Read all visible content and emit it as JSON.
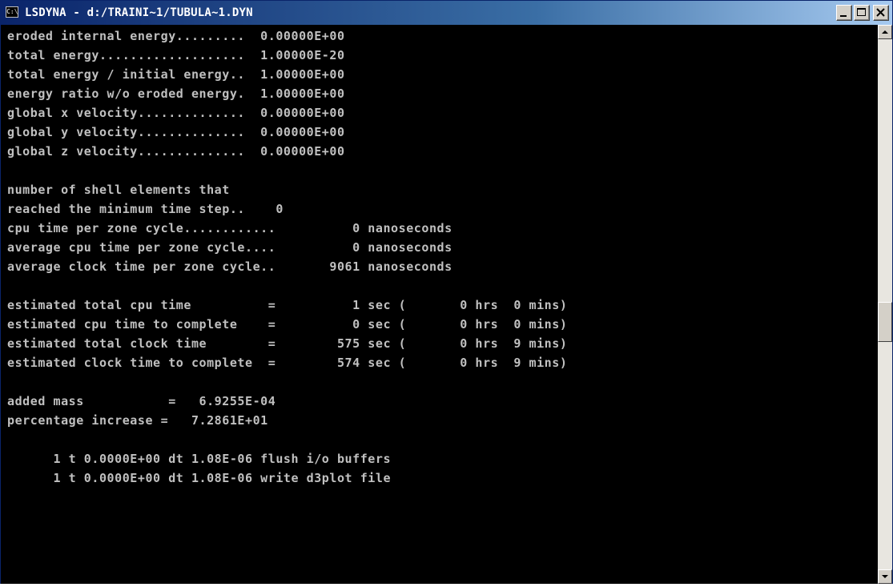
{
  "window": {
    "title": "LSDYNA - d:/TRAINI~1/TUBULA~1.DYN",
    "icon": "console-icon",
    "icon_text": "C:\\"
  },
  "console": {
    "lines": [
      "eroded internal energy.........  0.00000E+00",
      "total energy...................  1.00000E-20",
      "total energy / initial energy..  1.00000E+00",
      "energy ratio w/o eroded energy.  1.00000E+00",
      "global x velocity..............  0.00000E+00",
      "global y velocity..............  0.00000E+00",
      "global z velocity..............  0.00000E+00",
      "",
      "number of shell elements that",
      "reached the minimum time step..    0",
      "cpu time per zone cycle............          0 nanoseconds",
      "average cpu time per zone cycle....          0 nanoseconds",
      "average clock time per zone cycle..       9061 nanoseconds",
      "",
      "estimated total cpu time          =          1 sec (       0 hrs  0 mins)",
      "estimated cpu time to complete    =          0 sec (       0 hrs  0 mins)",
      "estimated total clock time        =        575 sec (       0 hrs  9 mins)",
      "estimated clock time to complete  =        574 sec (       0 hrs  9 mins)",
      "",
      "added mass           =   6.9255E-04",
      "percentage increase =   7.2861E+01",
      "",
      "      1 t 0.0000E+00 dt 1.08E-06 flush i/o buffers",
      "      1 t 0.0000E+00 dt 1.08E-06 write d3plot file"
    ]
  },
  "controls": {
    "minimize": "minimize-icon",
    "maximize": "maximize-icon",
    "close": "close-icon",
    "scroll_up": "arrow-up-icon",
    "scroll_down": "arrow-down-icon"
  }
}
